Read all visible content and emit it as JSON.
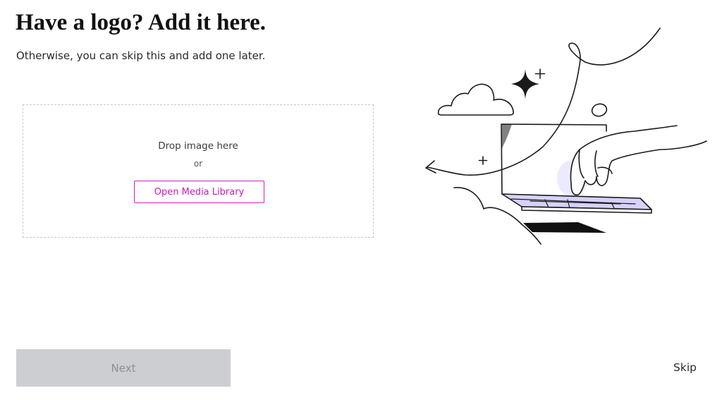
{
  "header": {
    "title": "Have a logo? Add it here.",
    "subtitle": "Otherwise, you can skip this and add one later."
  },
  "dropzone": {
    "prompt": "Drop image here",
    "separator": "or",
    "media_button_label": "Open Media Library"
  },
  "footer": {
    "next_label": "Next",
    "skip_label": "Skip"
  },
  "illustration": {
    "icon": "hand-on-laptop-illustration",
    "colors": {
      "ink": "#1a1a1a",
      "screen_accent": "#d6d2fb",
      "glow": "#eceafd"
    }
  },
  "colors": {
    "accent": "#d21fc0",
    "next_disabled_bg": "#ccced1",
    "next_disabled_text": "#8b8f94"
  }
}
